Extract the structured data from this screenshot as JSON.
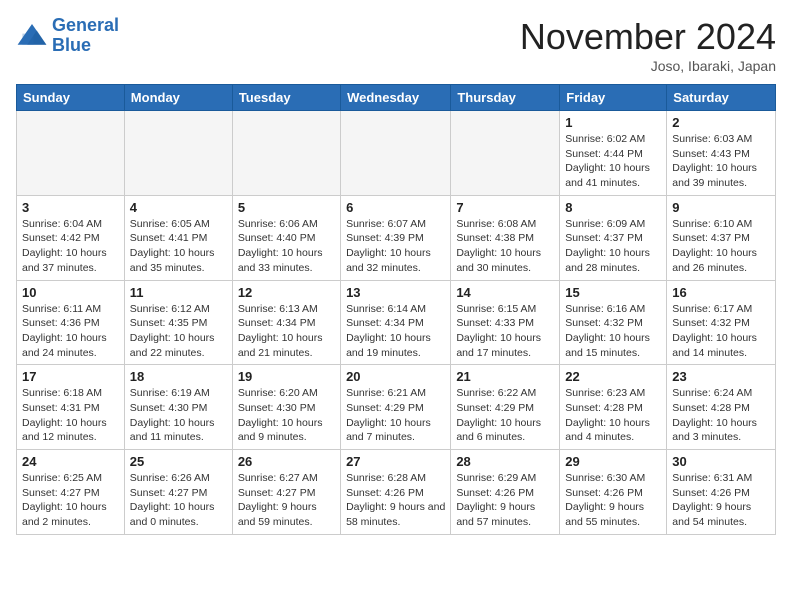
{
  "header": {
    "logo_line1": "General",
    "logo_line2": "Blue",
    "month_title": "November 2024",
    "location": "Joso, Ibaraki, Japan"
  },
  "days_of_week": [
    "Sunday",
    "Monday",
    "Tuesday",
    "Wednesday",
    "Thursday",
    "Friday",
    "Saturday"
  ],
  "weeks": [
    [
      {
        "day": "",
        "empty": true
      },
      {
        "day": "",
        "empty": true
      },
      {
        "day": "",
        "empty": true
      },
      {
        "day": "",
        "empty": true
      },
      {
        "day": "",
        "empty": true
      },
      {
        "day": "1",
        "info": "Sunrise: 6:02 AM\nSunset: 4:44 PM\nDaylight: 10 hours and 41 minutes."
      },
      {
        "day": "2",
        "info": "Sunrise: 6:03 AM\nSunset: 4:43 PM\nDaylight: 10 hours and 39 minutes."
      }
    ],
    [
      {
        "day": "3",
        "info": "Sunrise: 6:04 AM\nSunset: 4:42 PM\nDaylight: 10 hours and 37 minutes."
      },
      {
        "day": "4",
        "info": "Sunrise: 6:05 AM\nSunset: 4:41 PM\nDaylight: 10 hours and 35 minutes."
      },
      {
        "day": "5",
        "info": "Sunrise: 6:06 AM\nSunset: 4:40 PM\nDaylight: 10 hours and 33 minutes."
      },
      {
        "day": "6",
        "info": "Sunrise: 6:07 AM\nSunset: 4:39 PM\nDaylight: 10 hours and 32 minutes."
      },
      {
        "day": "7",
        "info": "Sunrise: 6:08 AM\nSunset: 4:38 PM\nDaylight: 10 hours and 30 minutes."
      },
      {
        "day": "8",
        "info": "Sunrise: 6:09 AM\nSunset: 4:37 PM\nDaylight: 10 hours and 28 minutes."
      },
      {
        "day": "9",
        "info": "Sunrise: 6:10 AM\nSunset: 4:37 PM\nDaylight: 10 hours and 26 minutes."
      }
    ],
    [
      {
        "day": "10",
        "info": "Sunrise: 6:11 AM\nSunset: 4:36 PM\nDaylight: 10 hours and 24 minutes."
      },
      {
        "day": "11",
        "info": "Sunrise: 6:12 AM\nSunset: 4:35 PM\nDaylight: 10 hours and 22 minutes."
      },
      {
        "day": "12",
        "info": "Sunrise: 6:13 AM\nSunset: 4:34 PM\nDaylight: 10 hours and 21 minutes."
      },
      {
        "day": "13",
        "info": "Sunrise: 6:14 AM\nSunset: 4:34 PM\nDaylight: 10 hours and 19 minutes."
      },
      {
        "day": "14",
        "info": "Sunrise: 6:15 AM\nSunset: 4:33 PM\nDaylight: 10 hours and 17 minutes."
      },
      {
        "day": "15",
        "info": "Sunrise: 6:16 AM\nSunset: 4:32 PM\nDaylight: 10 hours and 15 minutes."
      },
      {
        "day": "16",
        "info": "Sunrise: 6:17 AM\nSunset: 4:32 PM\nDaylight: 10 hours and 14 minutes."
      }
    ],
    [
      {
        "day": "17",
        "info": "Sunrise: 6:18 AM\nSunset: 4:31 PM\nDaylight: 10 hours and 12 minutes."
      },
      {
        "day": "18",
        "info": "Sunrise: 6:19 AM\nSunset: 4:30 PM\nDaylight: 10 hours and 11 minutes."
      },
      {
        "day": "19",
        "info": "Sunrise: 6:20 AM\nSunset: 4:30 PM\nDaylight: 10 hours and 9 minutes."
      },
      {
        "day": "20",
        "info": "Sunrise: 6:21 AM\nSunset: 4:29 PM\nDaylight: 10 hours and 7 minutes."
      },
      {
        "day": "21",
        "info": "Sunrise: 6:22 AM\nSunset: 4:29 PM\nDaylight: 10 hours and 6 minutes."
      },
      {
        "day": "22",
        "info": "Sunrise: 6:23 AM\nSunset: 4:28 PM\nDaylight: 10 hours and 4 minutes."
      },
      {
        "day": "23",
        "info": "Sunrise: 6:24 AM\nSunset: 4:28 PM\nDaylight: 10 hours and 3 minutes."
      }
    ],
    [
      {
        "day": "24",
        "info": "Sunrise: 6:25 AM\nSunset: 4:27 PM\nDaylight: 10 hours and 2 minutes."
      },
      {
        "day": "25",
        "info": "Sunrise: 6:26 AM\nSunset: 4:27 PM\nDaylight: 10 hours and 0 minutes."
      },
      {
        "day": "26",
        "info": "Sunrise: 6:27 AM\nSunset: 4:27 PM\nDaylight: 9 hours and 59 minutes."
      },
      {
        "day": "27",
        "info": "Sunrise: 6:28 AM\nSunset: 4:26 PM\nDaylight: 9 hours and 58 minutes."
      },
      {
        "day": "28",
        "info": "Sunrise: 6:29 AM\nSunset: 4:26 PM\nDaylight: 9 hours and 57 minutes."
      },
      {
        "day": "29",
        "info": "Sunrise: 6:30 AM\nSunset: 4:26 PM\nDaylight: 9 hours and 55 minutes."
      },
      {
        "day": "30",
        "info": "Sunrise: 6:31 AM\nSunset: 4:26 PM\nDaylight: 9 hours and 54 minutes."
      }
    ]
  ]
}
